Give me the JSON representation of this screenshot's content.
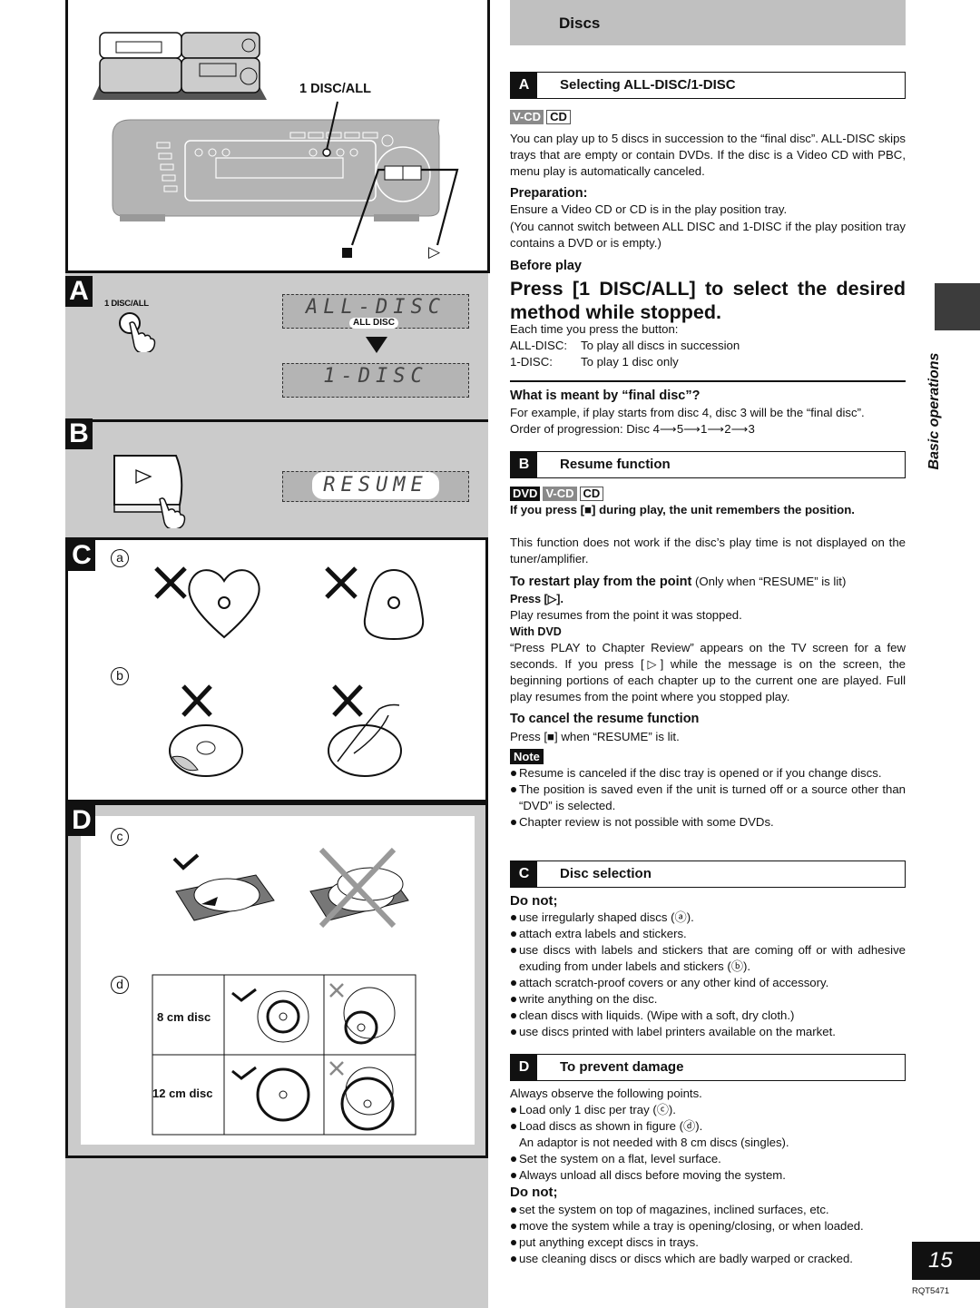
{
  "header": {
    "title": "Discs"
  },
  "side_tab": {
    "label": "Basic operations"
  },
  "footer": {
    "page_number": "15",
    "doc_code": "RQT5471"
  },
  "illustrations": {
    "top": {
      "callout_1disc_all": "1 DISC/ALL",
      "stop_symbol": "■",
      "play_symbol": "▷"
    },
    "A": {
      "letter": "A",
      "button_label": "1 DISC/ALL",
      "lcd_1": "ALL-DISC",
      "lcd_1_indicator": "ALL DISC",
      "lcd_2": "1-DISC"
    },
    "B": {
      "letter": "B",
      "play_symbol": "▷",
      "lcd": "RESUME"
    },
    "C": {
      "letter": "C",
      "label_a": "a",
      "label_b": "b"
    },
    "D": {
      "letter": "D",
      "label_c": "c",
      "label_d": "d",
      "row_8cm": "8 cm disc",
      "row_12cm": "12 cm disc"
    }
  },
  "sections": {
    "A": {
      "letter": "A",
      "title": "Selecting ALL-DISC/1-DISC",
      "badges": [
        "V-CD",
        "CD"
      ],
      "intro": "You can play up to 5 discs in succession to the “final disc”. ALL-DISC skips trays that are empty or contain DVDs. If the disc is a Video CD with PBC, menu play is automatically canceled.",
      "prep_heading": "Preparation:",
      "prep_1": "Ensure a Video CD or CD is in the play position tray.",
      "prep_2": "(You cannot switch between ALL DISC and 1-DISC if the play position tray contains a DVD or is empty.)",
      "before_heading": "Before play",
      "instruction": "Press [1 DISC/ALL] to select the desired method while stopped.",
      "each_time": "Each time you press the button:",
      "modes": [
        {
          "key": "ALL-DISC:",
          "desc": "To play all discs in succession"
        },
        {
          "key": "1-DISC:",
          "desc": "To play 1 disc only"
        }
      ],
      "final_heading": "What is meant by “final disc”?",
      "final_text": "For example, if play starts from disc 4, disc 3 will be the “final disc”.",
      "order_text": "Order of progression: Disc 4⟶5⟶1⟶2⟶3"
    },
    "B": {
      "letter": "B",
      "title": "Resume function",
      "badges": [
        "DVD",
        "V-CD",
        "CD"
      ],
      "lead": "If you press [■] during play, the unit remembers the position.",
      "lead_note": "This function does not work if the disc’s play time is not displayed on the tuner/amplifier.",
      "restart_heading": "To restart play from the point",
      "restart_cond": "(Only when “RESUME” is lit)",
      "press_play": "Press [▷].",
      "resume_text": "Play resumes from the point it was stopped.",
      "with_dvd_heading": "With DVD",
      "with_dvd_text": "“Press PLAY to Chapter Review” appears on the TV screen for a few seconds. If you press [▷] while the message is on the screen, the beginning portions of each chapter up to the current one are played. Full play resumes from the point where you stopped play.",
      "cancel_heading": "To cancel the resume function",
      "cancel_text": "Press [■] when “RESUME” is lit.",
      "note_label": "Note",
      "notes": [
        "Resume is canceled if the disc tray is opened or if you change discs.",
        "The position is saved even if the unit is turned off or a source other than “DVD” is selected.",
        "Chapter review is not possible with some DVDs."
      ]
    },
    "C": {
      "letter": "C",
      "title": "Disc selection",
      "donot_heading": "Do not;",
      "items": [
        "use irregularly shaped discs (ⓐ).",
        "attach extra labels and stickers.",
        "use discs with labels and stickers that are coming off or with adhesive exuding from under labels and stickers (ⓑ).",
        "attach scratch-proof covers or any other kind of accessory.",
        "write anything on the disc.",
        "clean discs with liquids. (Wipe with a soft, dry cloth.)",
        "use discs printed with label printers available on the market."
      ]
    },
    "D": {
      "letter": "D",
      "title": "To prevent damage",
      "intro": "Always observe the following points.",
      "items": [
        "Load only 1 disc per tray (ⓒ).",
        "Load discs as shown in figure (ⓓ).",
        "Set the system on a flat, level surface.",
        "Always unload all discs before moving the system."
      ],
      "adaptor_note": "An adaptor is not needed with 8 cm discs (singles).",
      "donot_heading": "Do not;",
      "donot_items": [
        "set the system on top of magazines, inclined surfaces, etc.",
        "move the system while a tray is opening/closing, or when loaded.",
        "put anything except discs in trays.",
        "use cleaning discs or discs which are badly warped or cracked."
      ]
    }
  }
}
